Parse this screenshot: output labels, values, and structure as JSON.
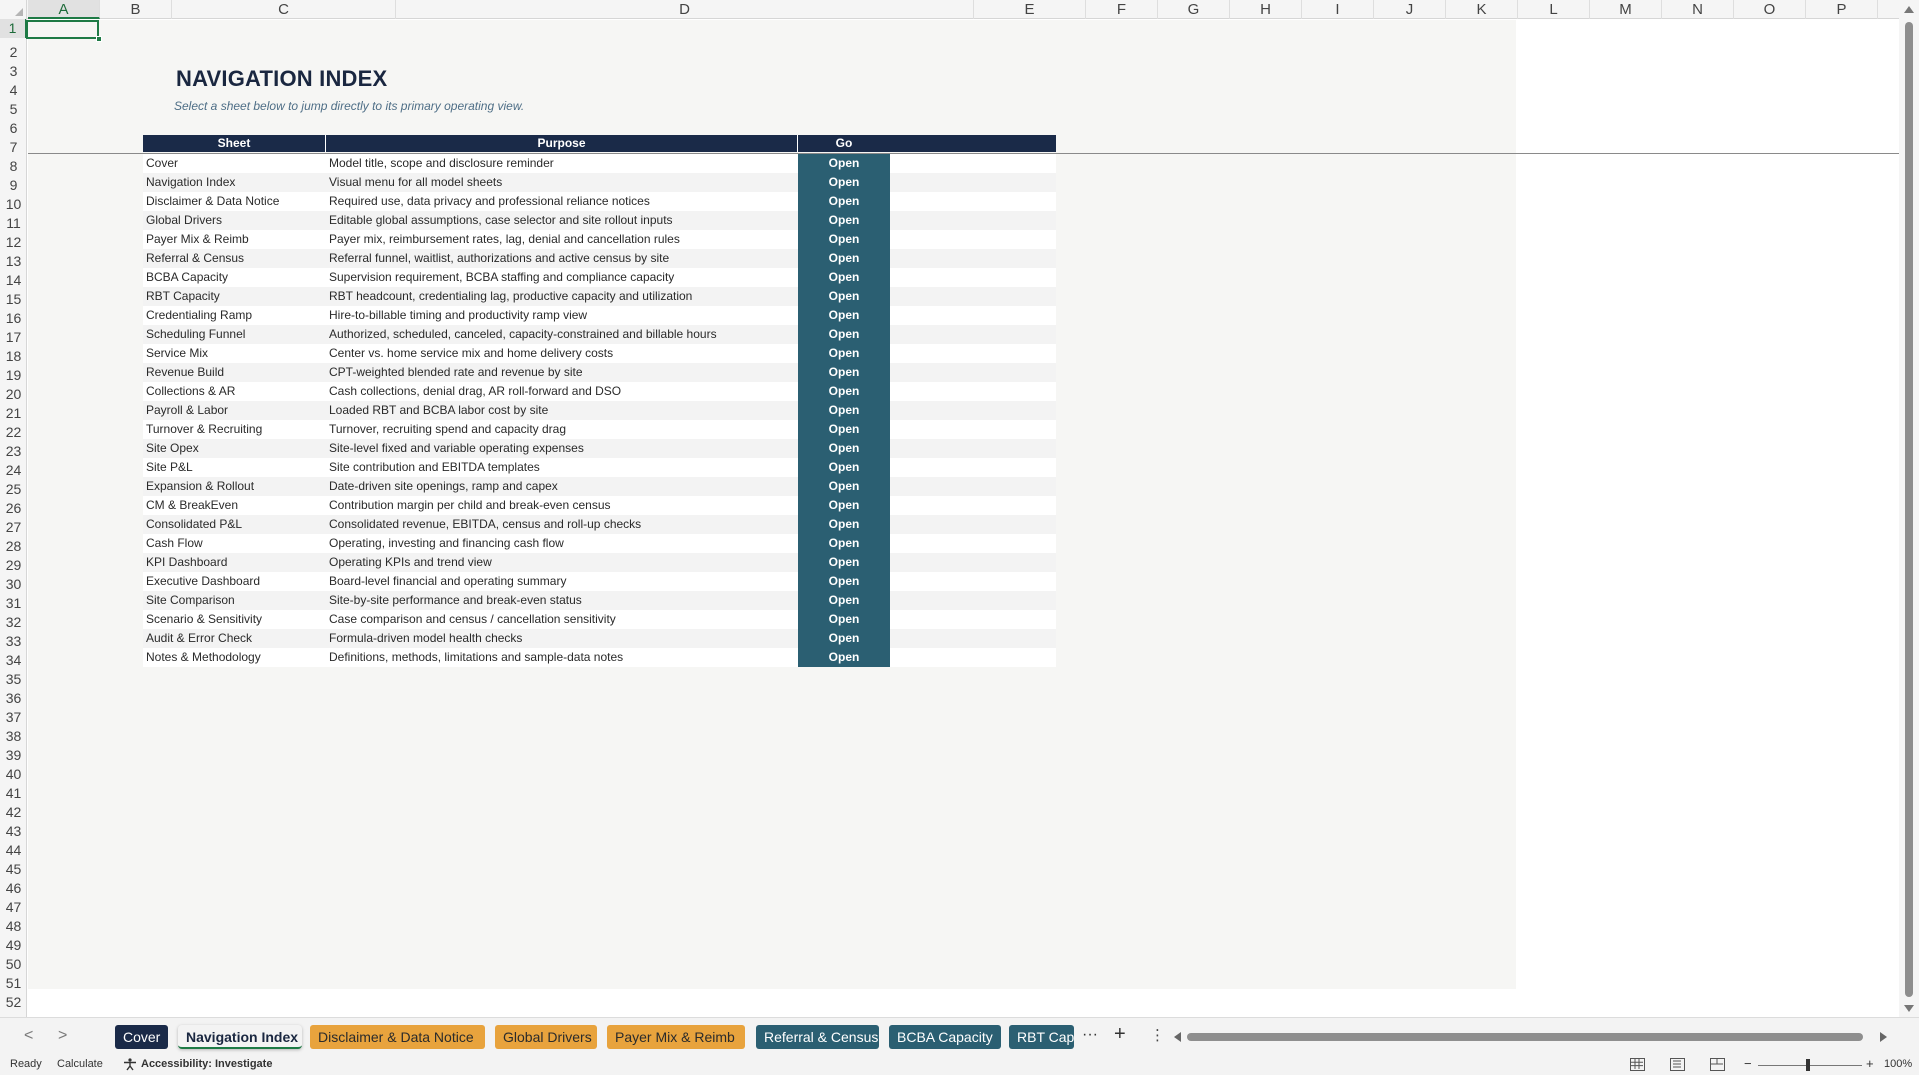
{
  "columns": [
    "A",
    "B",
    "C",
    "D",
    "E",
    "F",
    "G",
    "H",
    "I",
    "J",
    "K",
    "L",
    "M",
    "N",
    "O",
    "P"
  ],
  "active_column": "A",
  "rows": [
    "1",
    "2",
    "3",
    "4",
    "5",
    "6",
    "7",
    "8",
    "9",
    "10",
    "11",
    "12",
    "13",
    "14",
    "15",
    "16",
    "17",
    "18",
    "19",
    "20",
    "21",
    "22",
    "23",
    "24",
    "25",
    "26",
    "27",
    "28",
    "29",
    "30",
    "31",
    "32",
    "33",
    "34",
    "35",
    "36",
    "37",
    "38",
    "39",
    "40",
    "41",
    "42",
    "43",
    "44",
    "45",
    "46",
    "47",
    "48",
    "49",
    "50",
    "51",
    "52"
  ],
  "active_row": "1",
  "page": {
    "title": "NAVIGATION INDEX",
    "subtitle": "Select a sheet below to jump directly to its primary operating view."
  },
  "table": {
    "headers": {
      "sheet": "Sheet",
      "purpose": "Purpose",
      "go": "Go"
    },
    "rows": [
      {
        "sheet": "Cover",
        "purpose": "Model title, scope and disclosure reminder",
        "go": "Open"
      },
      {
        "sheet": "Navigation Index",
        "purpose": "Visual menu for all model sheets",
        "go": "Open"
      },
      {
        "sheet": "Disclaimer & Data Notice",
        "purpose": "Required use, data privacy and professional reliance notices",
        "go": "Open"
      },
      {
        "sheet": "Global Drivers",
        "purpose": "Editable global assumptions, case selector and site rollout inputs",
        "go": "Open"
      },
      {
        "sheet": "Payer Mix & Reimb",
        "purpose": "Payer mix, reimbursement rates, lag, denial and cancellation rules",
        "go": "Open"
      },
      {
        "sheet": "Referral & Census",
        "purpose": "Referral funnel, waitlist, authorizations and active census by site",
        "go": "Open"
      },
      {
        "sheet": "BCBA Capacity",
        "purpose": "Supervision requirement, BCBA staffing and compliance capacity",
        "go": "Open"
      },
      {
        "sheet": "RBT Capacity",
        "purpose": "RBT headcount, credentialing lag, productive capacity and utilization",
        "go": "Open"
      },
      {
        "sheet": "Credentialing Ramp",
        "purpose": "Hire-to-billable timing and productivity ramp view",
        "go": "Open"
      },
      {
        "sheet": "Scheduling Funnel",
        "purpose": "Authorized, scheduled, canceled, capacity-constrained and billable hours",
        "go": "Open"
      },
      {
        "sheet": "Service Mix",
        "purpose": "Center vs. home service mix and home delivery costs",
        "go": "Open"
      },
      {
        "sheet": "Revenue Build",
        "purpose": "CPT-weighted blended rate and revenue by site",
        "go": "Open"
      },
      {
        "sheet": "Collections & AR",
        "purpose": "Cash collections, denial drag, AR roll-forward and DSO",
        "go": "Open"
      },
      {
        "sheet": "Payroll & Labor",
        "purpose": "Loaded RBT and BCBA labor cost by site",
        "go": "Open"
      },
      {
        "sheet": "Turnover & Recruiting",
        "purpose": "Turnover, recruiting spend and capacity drag",
        "go": "Open"
      },
      {
        "sheet": "Site Opex",
        "purpose": "Site-level fixed and variable operating expenses",
        "go": "Open"
      },
      {
        "sheet": "Site P&L",
        "purpose": "Site contribution and EBITDA templates",
        "go": "Open"
      },
      {
        "sheet": "Expansion & Rollout",
        "purpose": "Date-driven site openings, ramp and capex",
        "go": "Open"
      },
      {
        "sheet": "CM & BreakEven",
        "purpose": "Contribution margin per child and break-even census",
        "go": "Open"
      },
      {
        "sheet": "Consolidated P&L",
        "purpose": "Consolidated revenue, EBITDA, census and roll-up checks",
        "go": "Open"
      },
      {
        "sheet": "Cash Flow",
        "purpose": "Operating, investing and financing cash flow",
        "go": "Open"
      },
      {
        "sheet": "KPI Dashboard",
        "purpose": "Operating KPIs and trend view",
        "go": "Open"
      },
      {
        "sheet": "Executive Dashboard",
        "purpose": "Board-level financial and operating summary",
        "go": "Open"
      },
      {
        "sheet": "Site Comparison",
        "purpose": "Site-by-site performance and break-even status",
        "go": "Open"
      },
      {
        "sheet": "Scenario & Sensitivity",
        "purpose": "Case comparison and census / cancellation sensitivity",
        "go": "Open"
      },
      {
        "sheet": "Audit & Error Check",
        "purpose": "Formula-driven model health checks",
        "go": "Open"
      },
      {
        "sheet": "Notes & Methodology",
        "purpose": "Definitions, methods, limitations and sample-data notes",
        "go": "Open"
      }
    ]
  },
  "tabs": [
    {
      "label": "Cover",
      "style": "dark"
    },
    {
      "label": "Navigation Index",
      "style": "active"
    },
    {
      "label": "Disclaimer & Data Notice",
      "style": "orange"
    },
    {
      "label": "Global Drivers",
      "style": "orange"
    },
    {
      "label": "Payer Mix & Reimb",
      "style": "orange"
    },
    {
      "label": "Referral & Census",
      "style": "teal"
    },
    {
      "label": "BCBA Capacity",
      "style": "teal"
    },
    {
      "label": "RBT Capa",
      "style": "teal"
    }
  ],
  "tab_controls": {
    "ellipsis": "···",
    "add": "+",
    "more": "⋮",
    "prev": "<",
    "next": ">"
  },
  "status": {
    "ready": "Ready",
    "calculate": "Calculate",
    "accessibility": "Accessibility: Investigate",
    "zoom_minus": "−",
    "zoom_plus": "+",
    "zoom": "100%"
  },
  "colors": {
    "header_navy": "#1a2a48",
    "go_teal": "#2b5f72",
    "tab_orange": "#e8a33d",
    "accent_green": "#1e7a45"
  },
  "icons": {
    "accessibility": "accessibility-icon",
    "normal_view": "normal-view-icon",
    "page_layout": "page-layout-icon",
    "page_break": "page-break-preview-icon"
  }
}
